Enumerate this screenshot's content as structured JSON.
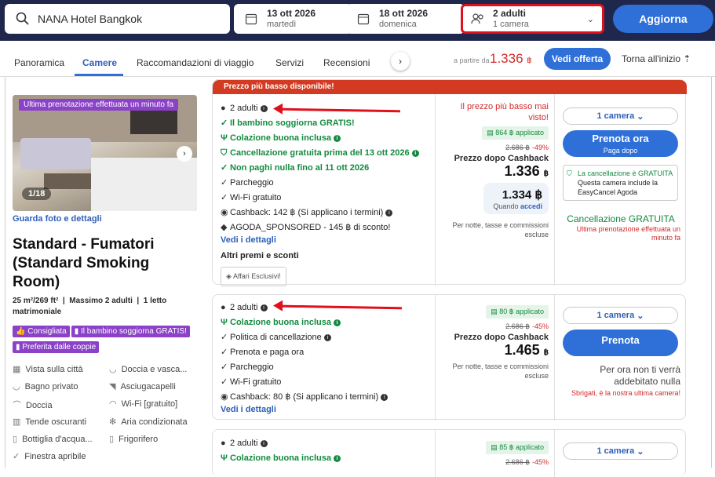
{
  "search": {
    "hotel": "NANA Hotel Bangkok"
  },
  "checkin": {
    "date": "13 ott 2026",
    "day": "martedì"
  },
  "checkout": {
    "date": "18 ott 2026",
    "day": "domenica"
  },
  "guests": {
    "adults": "2 adulti",
    "rooms": "1 camera"
  },
  "update_label": "Aggiorna",
  "tabs": [
    "Panoramica",
    "Camere",
    "Raccomandazioni di viaggio",
    "Servizi",
    "Recensioni"
  ],
  "from_label": "a partire da",
  "from_price": "1.336",
  "currency": "฿",
  "offer_label": "Vedi offerta",
  "top_label": "Torna all'inizio",
  "room": {
    "last_booked": "Ultima prenotazione effettuata un minuto fa",
    "photo_count": "1/18",
    "photo_link": "Guarda foto e dettagli",
    "title": "Standard - Fumatori (Standard Smoking Room)",
    "size": "25 m²/269 ft²",
    "max": "Massimo 2 adulti",
    "bed": "1 letto matrimoniale",
    "badges": [
      "Consigliata",
      "Il bambino soggiorna GRATIS!",
      "Preferita dalle coppie"
    ],
    "amenities": [
      "Vista sulla città",
      "Doccia e vasca...",
      "Bagno privato",
      "Asciugacapelli",
      "Doccia",
      "Wi-Fi [gratuito]",
      "Tende oscuranti",
      "Aria condizionata",
      "Bottiglia d'acqua...",
      "Frigorifero",
      "Finestra apribile"
    ]
  },
  "offer1": {
    "banner": "Prezzo più basso disponibile!",
    "adults": "2 adulti",
    "f1": "Il bambino soggiorna GRATIS!",
    "f2": "Colazione buona inclusa",
    "f3": "Cancellazione gratuita prima del 13 ott 2026",
    "f4": "Non paghi nulla fino al 11 ott 2026",
    "f5": "Parcheggio",
    "f6": "Wi-Fi gratuito",
    "f7": "Cashback: 142 ฿ (Si applicano i termini)",
    "f8": "AGODA_SPONSORED - 145 ฿ di sconto!",
    "details": "Vedi i dettagli",
    "other": "Altri premi e sconti",
    "excl": "Affari Esclusivi!",
    "lowest": "Il prezzo più basso mai visto!",
    "chip": "864 ฿ applicato",
    "old": "2.686 ฿",
    "disc": "-49%",
    "after": "Prezzo dopo Cashback",
    "price": "1.336",
    "acc_price": "1.334",
    "acc_label": "Quando",
    "acc_link": "accedi",
    "note": "Per notte, tasse e commissioni escluse",
    "rooms_sel": "1 camera",
    "book": "Prenota ora",
    "book_sub": "Paga dopo",
    "cb1": "La cancellazione è GRATUITA",
    "cb2": "Questa camera include la EasyCancel Agoda",
    "free": "Cancellazione GRATUITA",
    "last": "Ultima prenotazione effettuata un minuto fa"
  },
  "offer2": {
    "adults": "2 adulti",
    "f1": "Colazione buona inclusa",
    "f2": "Politica di cancellazione",
    "f3": "Prenota e paga ora",
    "f4": "Parcheggio",
    "f5": "Wi-Fi gratuito",
    "f6": "Cashback: 80 ฿ (Si applicano i termini)",
    "details": "Vedi i dettagli",
    "chip": "80 ฿ applicato",
    "old": "2.686 ฿",
    "disc": "-45%",
    "after": "Prezzo dopo Cashback",
    "price": "1.465",
    "note": "Per notte, tasse e commissioni escluse",
    "rooms_sel": "1 camera",
    "book": "Prenota",
    "nocharge": "Per ora non ti verrà addebitato nulla",
    "last": "Sbrigati, è la nostra ultima camera!"
  },
  "offer3": {
    "adults": "2 adulti",
    "f1": "Colazione buona inclusa",
    "chip": "85 ฿ applicato",
    "old": "2.686 ฿",
    "disc": "-45%",
    "rooms_sel": "1 camera"
  }
}
